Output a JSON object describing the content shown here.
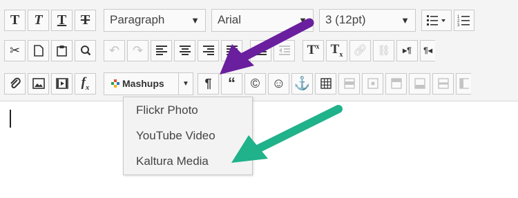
{
  "toolbar": {
    "block_format": "Paragraph",
    "font_family": "Arial",
    "font_size": "3 (12pt)",
    "mashups_label": "Mashups",
    "row1": [
      "T",
      "T",
      "T",
      "T"
    ],
    "superscript": "T",
    "subscript": "T",
    "quote_glyph": "“"
  },
  "mashups_menu": {
    "items": [
      "Flickr Photo",
      "YouTube Video",
      "Kaltura Media"
    ]
  },
  "colors": {
    "purple_arrow": "#6a1f9e",
    "green_arrow": "#20b28a",
    "mashups_dots": [
      "#e8512f",
      "#2f9e4c",
      "#2a78c9",
      "#f3b21c"
    ]
  }
}
